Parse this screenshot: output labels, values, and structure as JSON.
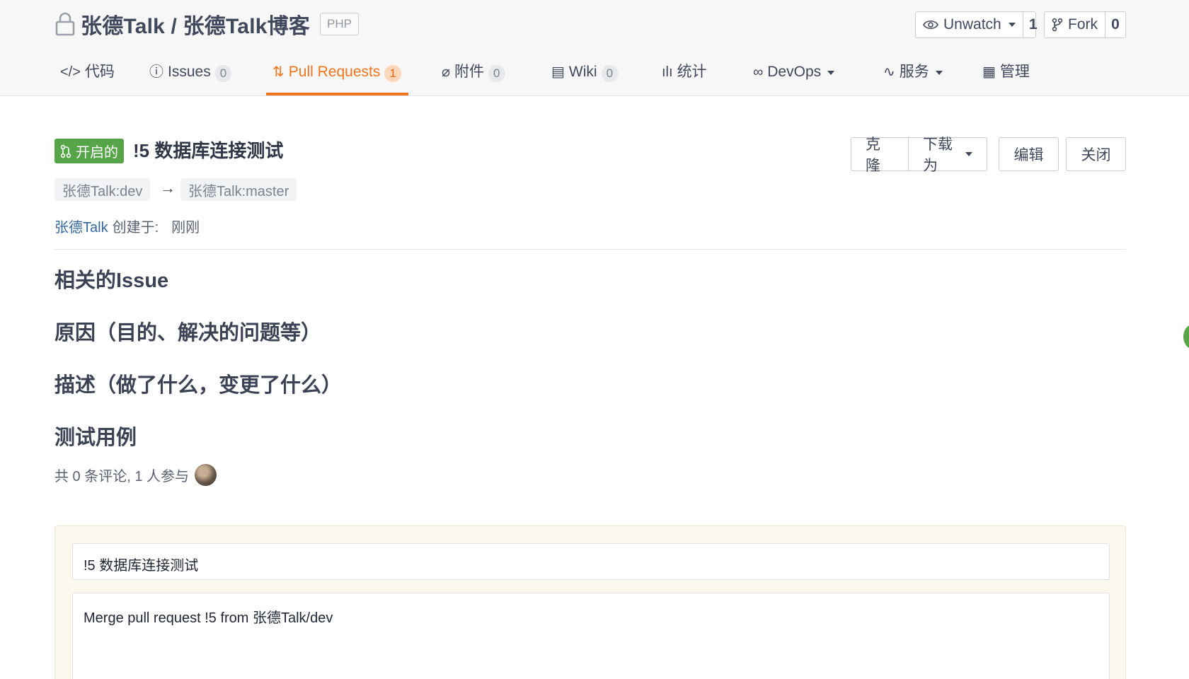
{
  "header": {
    "repo_name": "张德Talk / 张德Talk博客",
    "language": "PHP",
    "watch": {
      "label": "Unwatch",
      "count": "1"
    },
    "fork": {
      "label": "Fork",
      "count": "0"
    }
  },
  "tabs": [
    {
      "id": "code",
      "label": "代码",
      "icon": "code-icon",
      "badge": null
    },
    {
      "id": "issues",
      "label": "Issues",
      "icon": "issue-icon",
      "badge": "0"
    },
    {
      "id": "pulls",
      "label": "Pull Requests",
      "icon": "pull-request-icon",
      "badge": "1",
      "active": true
    },
    {
      "id": "attachments",
      "label": "附件",
      "icon": "paperclip-icon",
      "badge": "0"
    },
    {
      "id": "wiki",
      "label": "Wiki",
      "icon": "book-icon",
      "badge": "0"
    },
    {
      "id": "stats",
      "label": "统计",
      "icon": "bar-chart-icon",
      "badge": null
    },
    {
      "id": "devops",
      "label": "DevOps",
      "icon": "infinity-icon",
      "badge": null
    },
    {
      "id": "services",
      "label": "服务",
      "icon": "pulse-icon",
      "badge": null
    },
    {
      "id": "manage",
      "label": "管理",
      "icon": "document-icon",
      "badge": null
    }
  ],
  "pr": {
    "status": "开启的",
    "title": "!5 数据库连接测试",
    "source_branch": "张德Talk:dev",
    "target_branch": "张德Talk:master",
    "author": "张德Talk",
    "created_label": "创建于:",
    "created_time": "刚刚",
    "actions": {
      "clone": "克隆",
      "download": "下载为",
      "edit": "编辑",
      "close": "关闭"
    }
  },
  "sections": [
    "相关的Issue",
    "原因（目的、解决的问题等）",
    "描述（做了什么，变更了什么）",
    "测试用例"
  ],
  "comments_summary": "共 0 条评论, 1 人参与",
  "merge": {
    "title_value": "!5 数据库连接测试",
    "message_value": "Merge pull request !5 from 张德Talk/dev"
  },
  "colors": {
    "accent": "#f4741c",
    "status_open": "#56a549",
    "link": "#34679c"
  }
}
